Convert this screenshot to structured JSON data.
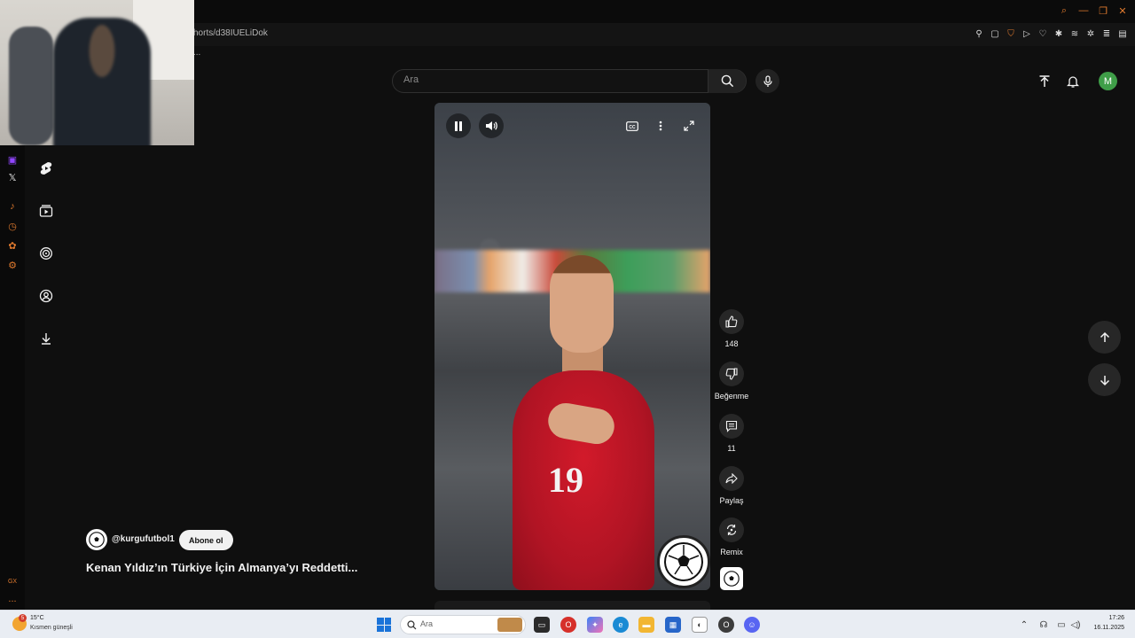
{
  "browser": {
    "url": "horts/d38IUELiDok",
    "bookmarks_overflow": "...",
    "window_controls": [
      "search-icon",
      "minimize-icon",
      "restore-icon",
      "close-icon"
    ],
    "extensions": [
      "pin-icon",
      "screenshot-icon",
      "shield-icon",
      "play-icon",
      "heart-icon",
      "extension-icon",
      "extension-icon",
      "extension-icon",
      "extension-icon",
      "menu-icon"
    ]
  },
  "gx_sidebar": {
    "items": [
      "twitch-icon",
      "x-icon",
      "music-icon",
      "clock-icon",
      "paw-icon",
      "wrench-icon"
    ],
    "footer": "GX",
    "more": "..."
  },
  "youtube": {
    "search": {
      "placeholder": "Ara"
    },
    "nav_icons": [
      "shorts-icon",
      "subscriptions-icon",
      "target-icon",
      "profile-icon",
      "download-icon"
    ],
    "avatar_letter": "M",
    "accent": "#3f9e48"
  },
  "video": {
    "jersey_number": "19",
    "controls": [
      "pause-icon",
      "volume-icon",
      "captions-icon",
      "more-icon",
      "fullscreen-icon"
    ]
  },
  "actions": {
    "like_count": "148",
    "dislike_label": "Beğenme",
    "comment_count": "11",
    "share_label": "Paylaş",
    "remix_label": "Remix"
  },
  "channel": {
    "handle": "@kurgufutbol1",
    "subscribe_label": "Abone ol"
  },
  "title": "Kenan Yıldız’ın Türkiye İçin Almanya’yı Reddetti...",
  "taskbar": {
    "weather_temp": "15°C",
    "weather_desc": "Kısmen güneşli",
    "weather_badge": "5",
    "search_placeholder": "Ara",
    "time": "17:26",
    "date": "16.11.2025"
  }
}
